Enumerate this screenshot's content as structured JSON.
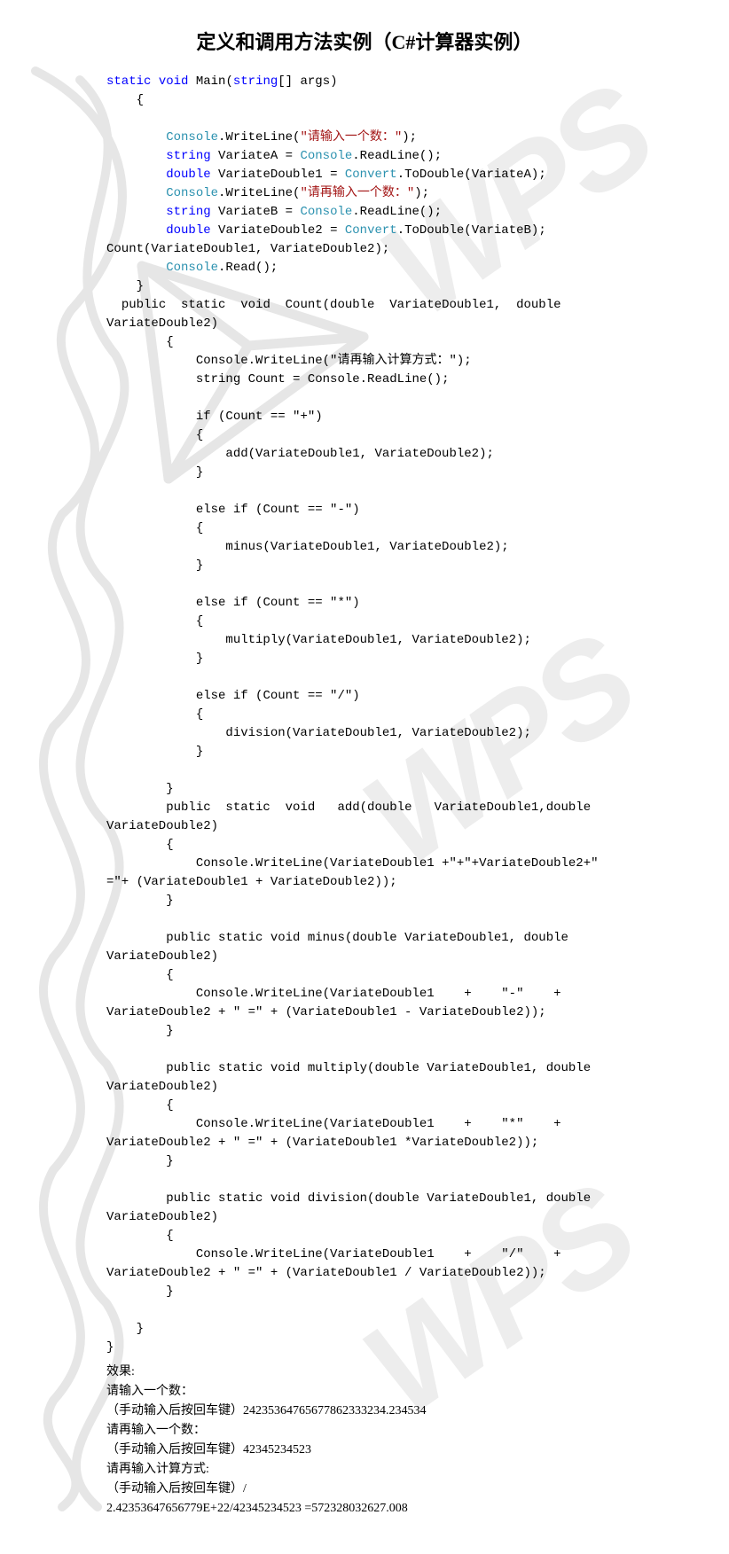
{
  "title": "定义和调用方法实例（C#计算器实例）",
  "code": {
    "l01a": "static",
    "l01b": " ",
    "l01c": "void",
    "l01d": " Main(",
    "l01e": "string",
    "l01f": "[] args)",
    "l02": "{",
    "l03a": "Console",
    "l03b": ".WriteLine(",
    "l03c": "\"请输入一个数：\"",
    "l03d": ");",
    "l04a": "string",
    "l04b": " VariateA = ",
    "l04c": "Console",
    "l04d": ".ReadLine();",
    "l05a": "double",
    "l05b": " VariateDouble1 = ",
    "l05c": "Convert",
    "l05d": ".ToDouble(VariateA);",
    "l06a": "Console",
    "l06b": ".WriteLine(",
    "l06c": "\"请再输入一个数：\"",
    "l06d": ");",
    "l07a": "string",
    "l07b": " VariateB = ",
    "l07c": "Console",
    "l07d": ".ReadLine();",
    "l08a": "double",
    "l08b": " VariateDouble2 = ",
    "l08c": "Convert",
    "l08d": ".ToDouble(VariateB);",
    "l09": "Count(VariateDouble1, VariateDouble2);",
    "l10a": "Console",
    "l10b": ".Read();",
    "l11": "}",
    "l12": "  public  static  void  Count(double  VariateDouble1,  double VariateDouble2)",
    "l13": "        {",
    "l14": "            Console.WriteLine(\"请再输入计算方式：\");",
    "l15": "            string Count = Console.ReadLine();",
    "l16": "",
    "l17": "            if (Count == \"+\")",
    "l18": "            {",
    "l19": "                add(VariateDouble1, VariateDouble2);",
    "l20": "            }",
    "l21": "",
    "l22": "            else if (Count == \"-\")",
    "l23": "            {",
    "l24": "                minus(VariateDouble1, VariateDouble2);",
    "l25": "            }",
    "l26": "",
    "l27": "            else if (Count == \"*\")",
    "l28": "            {",
    "l29": "                multiply(VariateDouble1, VariateDouble2);",
    "l30": "            }",
    "l31": "",
    "l32": "            else if (Count == \"/\")",
    "l33": "            {",
    "l34": "                division(VariateDouble1, VariateDouble2);",
    "l35": "            }",
    "l36": "",
    "l37": "        }",
    "l38": "        public  static  void   add(double   VariateDouble1,double VariateDouble2)",
    "l39": "        {",
    "l40": "            Console.WriteLine(VariateDouble1 +\"+\"+VariateDouble2+\" =\"+ (VariateDouble1 + VariateDouble2));",
    "l41": "        }",
    "l42": "",
    "l43": "        public static void minus(double VariateDouble1, double VariateDouble2)",
    "l44": "        {",
    "l45": "            Console.WriteLine(VariateDouble1    +    \"-\"    + VariateDouble2 + \" =\" + (VariateDouble1 - VariateDouble2));",
    "l46": "        }",
    "l47": "",
    "l48": "        public static void multiply(double VariateDouble1, double VariateDouble2)",
    "l49": "        {",
    "l50": "            Console.WriteLine(VariateDouble1    +    \"*\"    + VariateDouble2 + \" =\" + (VariateDouble1 *VariateDouble2));",
    "l51": "        }",
    "l52": "",
    "l53": "        public static void division(double VariateDouble1, double VariateDouble2)",
    "l54": "        {",
    "l55": "            Console.WriteLine(VariateDouble1    +    \"/\"    + VariateDouble2 + \" =\" + (VariateDouble1 / VariateDouble2));",
    "l56": "        }",
    "l57": "",
    "l58": "    }",
    "l59": "}"
  },
  "result": {
    "r0": "效果:",
    "r1": "请输入一个数：",
    "r2": "（手动输入后按回车键）24235364765677862333234.234534",
    "r3": "请再输入一个数：",
    "r4": "（手动输入后按回车键）42345234523",
    "r5": "请再输入计算方式:",
    "r6": "（手动输入后按回车键）/",
    "r7": "2.42353647656779E+22/42345234523 =572328032627.008"
  },
  "watermarks": {
    "wps": "WPS"
  }
}
